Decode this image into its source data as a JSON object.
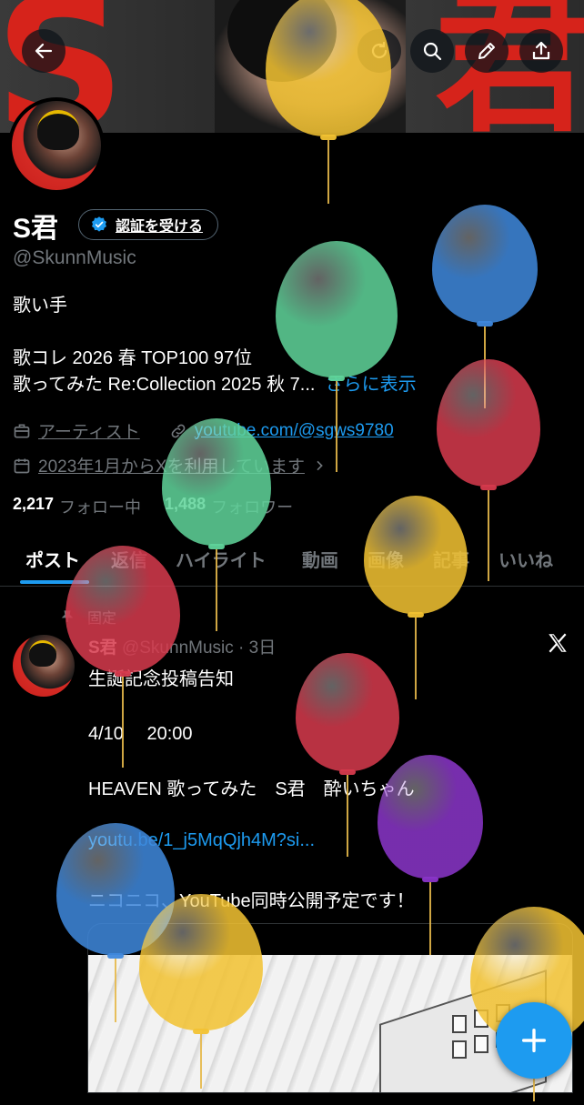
{
  "header": {
    "banner_letters": [
      "S",
      "君"
    ],
    "actions": [
      "back-icon",
      "refresh-icon",
      "search-icon",
      "edit-icon",
      "share-icon"
    ]
  },
  "profile": {
    "name": "S君",
    "verify_label": "認証を受ける",
    "handle": "@SkunnMusic",
    "bio": {
      "line1": "歌い手",
      "line2": "歌コレ 2026 春 TOP100 97位",
      "line3": "歌ってみた Re:Collection 2025 秋 7...",
      "more": "さらに表示"
    },
    "category": "アーティスト",
    "website": "youtube.com/@sgws9780",
    "joined": "2023年1月からXを利用しています",
    "following_count": "2,217",
    "following_label": "フォロー中",
    "followers_count": "1,488",
    "followers_label": "フォロワー"
  },
  "tabs": [
    "ポスト",
    "返信",
    "ハイライト",
    "動画",
    "画像",
    "記事",
    "いいね"
  ],
  "tweet": {
    "pinned_label": "固定",
    "name": "S君",
    "handle_time": "@SkunnMusic · 3日",
    "lines": [
      "生誕記念投稿告知",
      "4/10　 20:00",
      "HEAVEN 歌ってみた　S君　酔いちゃん",
      "youtu.be/1_j5MqQjh4M?si...",
      "ニコニコ、YouTube同時公開予定です！"
    ]
  },
  "colors": {
    "accent": "#1d9bf0",
    "background": "#000000",
    "banner_red": "#d6231b",
    "balloon_yellow": "#f2c232",
    "balloon_blue": "#3f88dc",
    "balloon_green": "#5fd49a",
    "balloon_red": "#d63a4d",
    "balloon_purple": "#8a35c9"
  }
}
